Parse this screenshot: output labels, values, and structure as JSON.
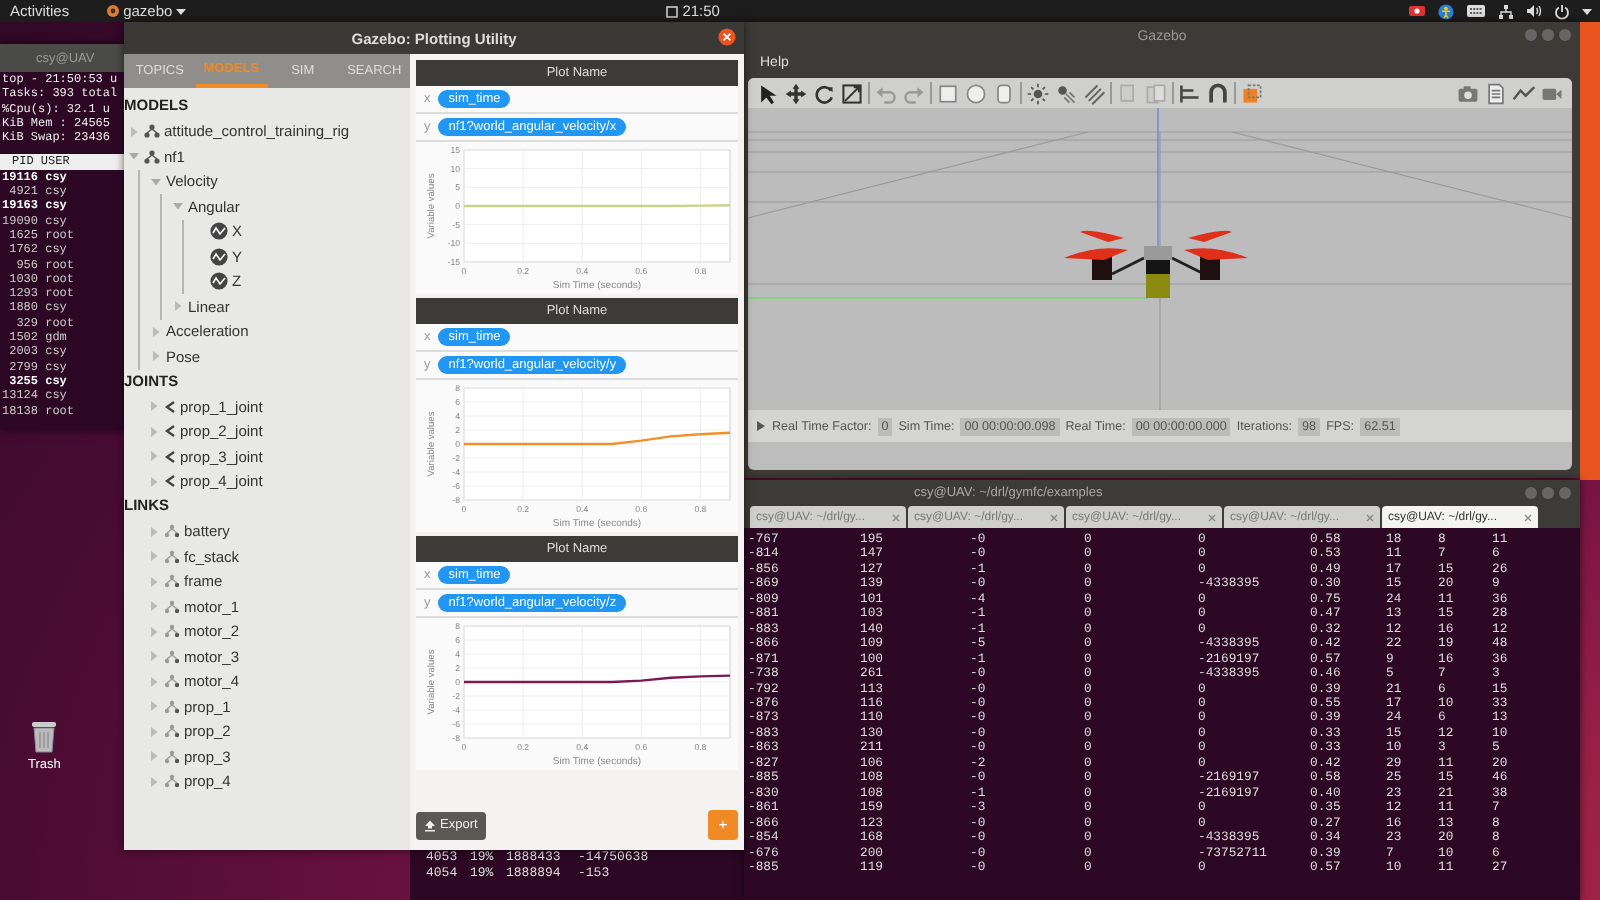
{
  "top_bar": {
    "activities": "Activities",
    "app_menu": "gazebo",
    "clock": "21:50"
  },
  "desktop": {
    "trash_label": "Trash"
  },
  "top_terminal": {
    "title": "csy@UAV",
    "summary": [
      "top - 21:50:53 u",
      "Tasks: 393 total",
      "%Cpu(s): 32.1 u",
      "KiB Mem : 24565",
      "KiB Swap: 23436"
    ],
    "header": "PID USER",
    "rows": [
      {
        "text": "19116 csy",
        "bold": true
      },
      {
        "text": " 4921 csy",
        "bold": false
      },
      {
        "text": "19163 csy",
        "bold": true
      },
      {
        "text": "19090 csy",
        "bold": false
      },
      {
        "text": " 1625 root",
        "bold": false
      },
      {
        "text": " 1762 csy",
        "bold": false
      },
      {
        "text": "  956 root",
        "bold": false
      },
      {
        "text": " 1030 root",
        "bold": false
      },
      {
        "text": " 1293 root",
        "bold": false
      },
      {
        "text": " 1880 csy",
        "bold": false
      },
      {
        "text": "  329 root",
        "bold": false
      },
      {
        "text": " 1502 gdm",
        "bold": false
      },
      {
        "text": " 2003 csy",
        "bold": false
      },
      {
        "text": " 2799 csy",
        "bold": false
      },
      {
        "text": " 3255 csy",
        "bold": true
      },
      {
        "text": "13124 csy",
        "bold": false
      },
      {
        "text": "18138 root",
        "bold": false
      }
    ]
  },
  "back_terminal_lines": [
    [
      "4053",
      "19%",
      "1888433",
      "-14750638"
    ],
    [
      "4054",
      "19%",
      "1888894",
      "-153"
    ]
  ],
  "plot_window": {
    "title": "Gazebo: Plotting Utility",
    "tabs": [
      {
        "label": "TOPICS",
        "selected": false
      },
      {
        "label": "MODELS",
        "selected": true
      },
      {
        "label": "SIM",
        "selected": false
      },
      {
        "label": "SEARCH",
        "selected": false
      }
    ],
    "tree": [
      {
        "label": "MODELS",
        "kind": "heading"
      },
      {
        "label": "attitude_control_training_rig",
        "kind": "model",
        "expanded": false
      },
      {
        "label": "nf1",
        "kind": "model",
        "expanded": true,
        "children": [
          {
            "label": "Velocity",
            "kind": "group",
            "expanded": true,
            "children": [
              {
                "label": "Angular",
                "kind": "group",
                "expanded": true,
                "children": [
                  {
                    "label": "X",
                    "kind": "variable"
                  },
                  {
                    "label": "Y",
                    "kind": "variable"
                  },
                  {
                    "label": "Z",
                    "kind": "variable"
                  }
                ]
              },
              {
                "label": "Linear",
                "kind": "group",
                "expanded": false
              }
            ]
          },
          {
            "label": "Acceleration",
            "kind": "group",
            "expanded": false
          },
          {
            "label": "Pose",
            "kind": "group",
            "expanded": false
          }
        ]
      },
      {
        "label": "JOINTS",
        "kind": "heading"
      },
      {
        "label": "prop_1_joint",
        "kind": "joint",
        "expanded": false
      },
      {
        "label": "prop_2_joint",
        "kind": "joint",
        "expanded": false
      },
      {
        "label": "prop_3_joint",
        "kind": "joint",
        "expanded": false
      },
      {
        "label": "prop_4_joint",
        "kind": "joint",
        "expanded": false
      },
      {
        "label": "LINKS",
        "kind": "heading"
      },
      {
        "label": "battery",
        "kind": "link",
        "expanded": false
      },
      {
        "label": "fc_stack",
        "kind": "link",
        "expanded": false
      },
      {
        "label": "frame",
        "kind": "link",
        "expanded": false
      },
      {
        "label": "motor_1",
        "kind": "link",
        "expanded": false
      },
      {
        "label": "motor_2",
        "kind": "link",
        "expanded": false
      },
      {
        "label": "motor_3",
        "kind": "link",
        "expanded": false
      },
      {
        "label": "motor_4",
        "kind": "link",
        "expanded": false
      },
      {
        "label": "prop_1",
        "kind": "link",
        "expanded": false
      },
      {
        "label": "prop_2",
        "kind": "link",
        "expanded": false
      },
      {
        "label": "prop_3",
        "kind": "link",
        "expanded": false
      },
      {
        "label": "prop_4",
        "kind": "link",
        "expanded": false
      }
    ],
    "plots": [
      {
        "title": "Plot Name",
        "x_axis": "x",
        "x_variable": "sim_time",
        "y_axis": "y",
        "y_variable": "nf1?world_angular_velocity/x",
        "chart_data": {
          "type": "line",
          "xlabel": "Sim Time (seconds)",
          "ylabel": "Variable values",
          "x": [
            0,
            0.1,
            0.2,
            0.3,
            0.4,
            0.5,
            0.6,
            0.7,
            0.8,
            0.9
          ],
          "grid": true,
          "series": [
            {
              "color": "#c8d48a",
              "values": [
                0,
                0,
                0,
                0,
                0,
                0,
                0,
                0,
                0.1,
                0.2
              ]
            }
          ],
          "xlim": [
            0,
            0.9
          ],
          "ylim": [
            -15,
            15
          ],
          "xticks": [
            0,
            0.2,
            0.4,
            0.6,
            0.8
          ],
          "yticks": [
            -15,
            -10,
            -5,
            0,
            5,
            10,
            15
          ]
        }
      },
      {
        "title": "Plot Name",
        "x_axis": "x",
        "x_variable": "sim_time",
        "y_axis": "y",
        "y_variable": "nf1?world_angular_velocity/y",
        "chart_data": {
          "type": "line",
          "xlabel": "Sim Time (seconds)",
          "ylabel": "Variable values",
          "x": [
            0,
            0.1,
            0.2,
            0.3,
            0.4,
            0.5,
            0.6,
            0.7,
            0.8,
            0.9
          ],
          "grid": true,
          "series": [
            {
              "color": "#f0902a",
              "values": [
                0,
                0,
                0,
                0,
                0,
                0,
                0.5,
                1.1,
                1.4,
                1.6
              ]
            }
          ],
          "xlim": [
            0,
            0.9
          ],
          "ylim": [
            -8,
            8
          ],
          "xticks": [
            0,
            0.2,
            0.4,
            0.6,
            0.8
          ],
          "yticks": [
            -8,
            -6,
            -4,
            -2,
            0,
            2,
            4,
            6,
            8
          ]
        }
      },
      {
        "title": "Plot Name",
        "x_axis": "x",
        "x_variable": "sim_time",
        "y_axis": "y",
        "y_variable": "nf1?world_angular_velocity/z",
        "chart_data": {
          "type": "line",
          "xlabel": "Sim Time (seconds)",
          "ylabel": "Variable values",
          "x": [
            0,
            0.1,
            0.2,
            0.3,
            0.4,
            0.5,
            0.6,
            0.7,
            0.8,
            0.9
          ],
          "grid": true,
          "series": [
            {
              "color": "#7a1858",
              "values": [
                0,
                0,
                0,
                0,
                0,
                0,
                0.2,
                0.6,
                0.8,
                0.9
              ]
            }
          ],
          "xlim": [
            0,
            0.9
          ],
          "ylim": [
            -8,
            8
          ],
          "xticks": [
            0,
            0.2,
            0.4,
            0.6,
            0.8
          ],
          "yticks": [
            -8,
            -6,
            -4,
            -2,
            0,
            2,
            4,
            6,
            8
          ]
        }
      }
    ],
    "export_label": "Export",
    "add_label": "+"
  },
  "gazebo": {
    "title": "Gazebo",
    "menu": [
      "Help"
    ],
    "status_fields": [
      {
        "label": "Real Time Factor:",
        "value": "0"
      },
      {
        "label": "Sim Time:",
        "value": "00 00:00:00.098"
      },
      {
        "label": "Real Time:",
        "value": "00 00:00:00.000"
      },
      {
        "label": "Iterations:",
        "value": "98"
      },
      {
        "label": "FPS:",
        "value": "62.51"
      }
    ]
  },
  "terminal": {
    "title": "csy@UAV: ~/drl/gymfc/examples",
    "tabs": [
      {
        "label": "csy@UAV: ~/drl/gy...",
        "selected": false
      },
      {
        "label": "csy@UAV: ~/drl/gy...",
        "selected": false
      },
      {
        "label": "csy@UAV: ~/drl/gy...",
        "selected": false
      },
      {
        "label": "csy@UAV: ~/drl/gy...",
        "selected": false
      },
      {
        "label": "csy@UAV: ~/drl/gy...",
        "selected": true
      }
    ],
    "rows": [
      [
        "-767",
        "195",
        "-0",
        "0",
        "0",
        "0.58",
        "18",
        "8",
        "11"
      ],
      [
        "-814",
        "147",
        "-0",
        "0",
        "0",
        "0.53",
        "11",
        "7",
        "6"
      ],
      [
        "-856",
        "127",
        "-1",
        "0",
        "0",
        "0.49",
        "17",
        "15",
        "26"
      ],
      [
        "-869",
        "139",
        "-0",
        "0",
        "-4338395",
        "0.30",
        "15",
        "20",
        "9"
      ],
      [
        "-809",
        "101",
        "-4",
        "0",
        "0",
        "0.75",
        "24",
        "11",
        "36"
      ],
      [
        "-881",
        "103",
        "-1",
        "0",
        "0",
        "0.47",
        "13",
        "15",
        "28"
      ],
      [
        "-883",
        "140",
        "-1",
        "0",
        "0",
        "0.32",
        "12",
        "16",
        "12"
      ],
      [
        "-866",
        "109",
        "-5",
        "0",
        "-4338395",
        "0.42",
        "22",
        "19",
        "48"
      ],
      [
        "-871",
        "100",
        "-1",
        "0",
        "-2169197",
        "0.57",
        "9",
        "16",
        "36"
      ],
      [
        "-738",
        "261",
        "-0",
        "0",
        "-4338395",
        "0.46",
        "5",
        "7",
        "3"
      ],
      [
        "-792",
        "113",
        "-0",
        "0",
        "0",
        "0.39",
        "21",
        "6",
        "15"
      ],
      [
        "-876",
        "116",
        "-0",
        "0",
        "0",
        "0.55",
        "17",
        "10",
        "33"
      ],
      [
        "-873",
        "110",
        "-0",
        "0",
        "0",
        "0.39",
        "24",
        "6",
        "13"
      ],
      [
        "-883",
        "130",
        "-0",
        "0",
        "0",
        "0.33",
        "15",
        "12",
        "10"
      ],
      [
        "-863",
        "211",
        "-0",
        "0",
        "0",
        "0.33",
        "10",
        "3",
        "5"
      ],
      [
        "-827",
        "106",
        "-2",
        "0",
        "0",
        "0.42",
        "29",
        "11",
        "20"
      ],
      [
        "-885",
        "108",
        "-0",
        "0",
        "-2169197",
        "0.58",
        "25",
        "15",
        "46"
      ],
      [
        "-830",
        "108",
        "-1",
        "0",
        "-2169197",
        "0.40",
        "23",
        "21",
        "38"
      ],
      [
        "-861",
        "159",
        "-3",
        "0",
        "0",
        "0.35",
        "12",
        "11",
        "7"
      ],
      [
        "-866",
        "123",
        "-0",
        "0",
        "0",
        "0.27",
        "16",
        "13",
        "8"
      ],
      [
        "-854",
        "168",
        "-0",
        "0",
        "-4338395",
        "0.34",
        "23",
        "20",
        "8"
      ],
      [
        "-676",
        "200",
        "-0",
        "0",
        "-73752711",
        "0.39",
        "7",
        "10",
        "6"
      ],
      [
        "-885",
        "119",
        "-0",
        "0",
        "0",
        "0.57",
        "10",
        "11",
        "27"
      ]
    ]
  }
}
